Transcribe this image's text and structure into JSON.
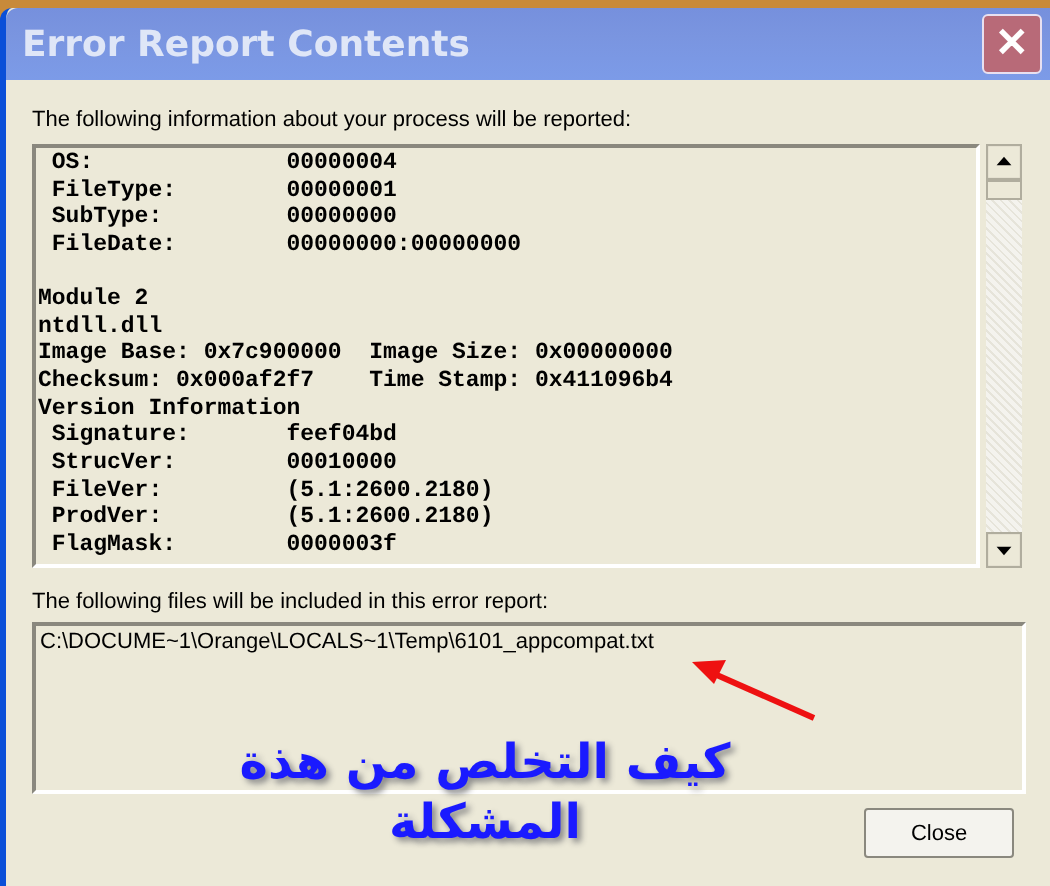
{
  "window": {
    "title": "Error Report Contents",
    "close_glyph": "✕"
  },
  "report": {
    "label": "The following information about your process will be reported:",
    "sections": [
      [
        " OS:              00000004",
        " FileType:        00000001",
        " SubType:         00000000",
        " FileDate:        00000000:00000000"
      ],
      [
        "Module 2",
        "ntdll.dll",
        "Image Base: 0x7c900000  Image Size: 0x00000000",
        "Checksum: 0x000af2f7    Time Stamp: 0x411096b4",
        "Version Information",
        " Signature:       feef04bd",
        " StrucVer:        00010000",
        " FileVer:         (5.1:2600.2180)",
        " ProdVer:         (5.1:2600.2180)",
        " FlagMask:        0000003f"
      ]
    ]
  },
  "files": {
    "label": "The following files will be included in this error report:",
    "items": [
      "C:\\DOCUME~1\\Orange\\LOCALS~1\\Temp\\6101_appcompat.txt"
    ]
  },
  "annotation": {
    "text": "كيف التخلص من هذة المشكلة"
  },
  "buttons": [
    "Close"
  ]
}
